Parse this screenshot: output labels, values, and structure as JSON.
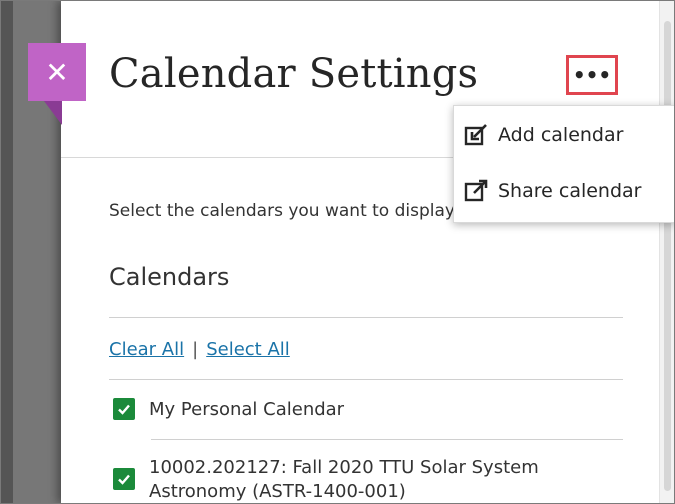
{
  "panel": {
    "title": "Calendar Settings",
    "intro": "Select the calendars you want to display"
  },
  "menu": {
    "items": [
      {
        "label": "Add calendar",
        "icon": "add-calendar-icon"
      },
      {
        "label": "Share calendar",
        "icon": "share-calendar-icon"
      }
    ]
  },
  "calendars": {
    "heading": "Calendars",
    "clear_all": "Clear All",
    "separator": "|",
    "select_all": "Select All",
    "items": [
      {
        "line1": "My Personal Calendar",
        "line2": "",
        "checked": true
      },
      {
        "line1": "10002.202127: Fall 2020 TTU Solar System",
        "line2": "Astronomy (ASTR-1400-001)",
        "checked": true
      }
    ]
  },
  "colors": {
    "accent": "#c064c6",
    "highlight": "#e0454f",
    "check": "#1b8a3a",
    "link": "#1a73a8"
  }
}
